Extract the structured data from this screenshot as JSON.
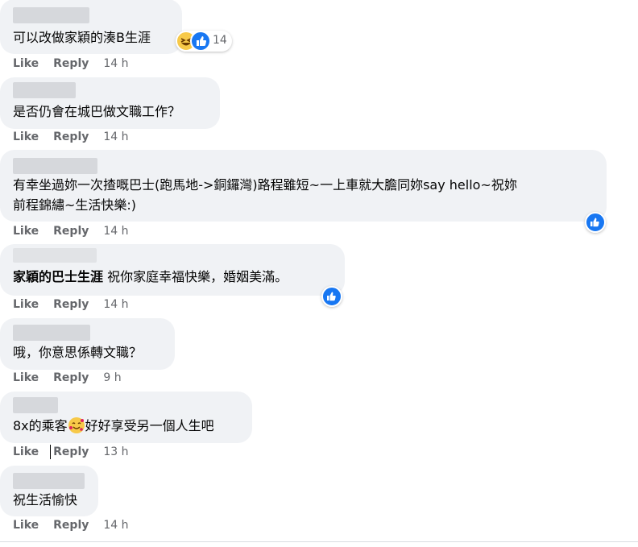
{
  "comments": [
    {
      "text": "可以改做家穎的湊B生涯",
      "like": "Like",
      "reply": "Reply",
      "time": "14 h",
      "reaction_count": "14"
    },
    {
      "text": "是否仍會在城巴做文職工作？",
      "like": "Like",
      "reply": "Reply",
      "time": "14 h"
    },
    {
      "text_line1": "有幸坐過妳一次揸嘅巴士(跑馬地->銅鑼灣)路程雖短~一上車就大膽同妳say hello~祝妳",
      "text_line2": "前程錦繡~生活快樂:)",
      "like": "Like",
      "reply": "Reply",
      "time": "14 h"
    },
    {
      "author": "家穎的巴士生涯",
      "text": "祝你家庭幸福快樂，婚姻美滿。",
      "like": "Like",
      "reply": "Reply",
      "time": "14 h"
    },
    {
      "text": "哦，你意思係轉文職？",
      "like": "Like",
      "reply": "Reply",
      "time": "9 h"
    },
    {
      "text_before_emoji": "8x的乘客",
      "text_after_emoji": "好好享受另一個人生吧",
      "like": "Like",
      "reply": "Reply",
      "time": "13 h"
    },
    {
      "text": "祝生活愉快",
      "like": "Like",
      "reply": "Reply",
      "time": "14 h"
    }
  ],
  "colors": {
    "bubble": "#f0f2f5",
    "meta": "#65676b",
    "like_blue": "#1877f2",
    "haha_yellow": "#f7c948"
  },
  "icons": {
    "like": "thumbs-up-icon",
    "haha": "haha-face-icon",
    "smile_hearts": "smiling-face-with-hearts-icon"
  }
}
